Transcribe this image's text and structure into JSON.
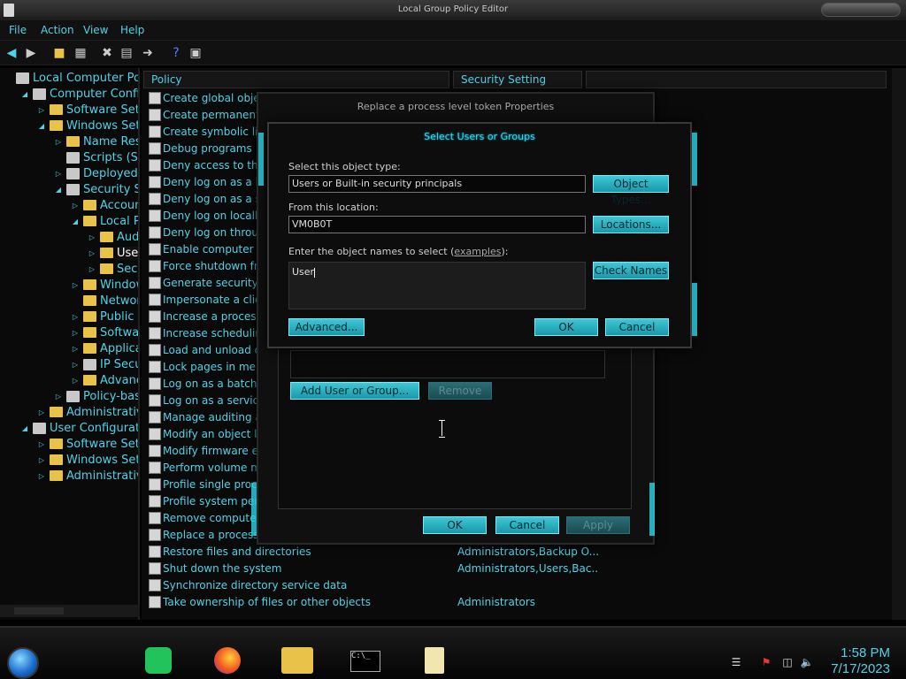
{
  "window": {
    "title": "Local Group Policy Editor"
  },
  "menu": [
    "File",
    "Action",
    "View",
    "Help"
  ],
  "toolbar": {
    "icons": [
      "back-arrow-icon",
      "forward-arrow-icon",
      "up-folder-icon",
      "show-hide-tree-icon",
      "delete-icon",
      "properties-icon",
      "export-list-icon",
      "help-icon",
      "show-action-pane-icon"
    ]
  },
  "tree": [
    {
      "label": "Local Computer Policy",
      "indent": 0,
      "icon": "policy",
      "toggle": ""
    },
    {
      "label": "Computer Configura",
      "indent": 1,
      "icon": "computer",
      "toggle": "down"
    },
    {
      "label": "Software Setting",
      "indent": 2,
      "icon": "folder",
      "toggle": "right"
    },
    {
      "label": "Windows Settin",
      "indent": 2,
      "icon": "folder",
      "toggle": "down"
    },
    {
      "label": "Name Resol",
      "indent": 3,
      "icon": "folder",
      "toggle": "right"
    },
    {
      "label": "Scripts (Star",
      "indent": 3,
      "icon": "page",
      "toggle": ""
    },
    {
      "label": "Deployed Pr",
      "indent": 3,
      "icon": "printer",
      "toggle": "right"
    },
    {
      "label": "Security Set",
      "indent": 3,
      "icon": "security",
      "toggle": "down"
    },
    {
      "label": "Account",
      "indent": 4,
      "icon": "folder",
      "toggle": "right"
    },
    {
      "label": "Local Po",
      "indent": 4,
      "icon": "folder",
      "toggle": "down"
    },
    {
      "label": "Audit",
      "indent": 5,
      "icon": "folder",
      "toggle": "right"
    },
    {
      "label": "User I",
      "indent": 5,
      "icon": "folder",
      "toggle": "right",
      "selected": true
    },
    {
      "label": "Secur",
      "indent": 5,
      "icon": "folder",
      "toggle": "right"
    },
    {
      "label": "Windows",
      "indent": 4,
      "icon": "folder",
      "toggle": "right"
    },
    {
      "label": "Network",
      "indent": 4,
      "icon": "folder",
      "toggle": ""
    },
    {
      "label": "Public Ke",
      "indent": 4,
      "icon": "folder",
      "toggle": "right"
    },
    {
      "label": "Software",
      "indent": 4,
      "icon": "folder",
      "toggle": "right"
    },
    {
      "label": "Applicati",
      "indent": 4,
      "icon": "folder",
      "toggle": "right"
    },
    {
      "label": "IP Securi",
      "indent": 4,
      "icon": "security",
      "toggle": "right"
    },
    {
      "label": "Advance",
      "indent": 4,
      "icon": "folder",
      "toggle": "right"
    },
    {
      "label": "Policy-base",
      "indent": 3,
      "icon": "chart",
      "toggle": "right"
    },
    {
      "label": "Administrative T",
      "indent": 2,
      "icon": "folder",
      "toggle": "right"
    },
    {
      "label": "User Configuration",
      "indent": 1,
      "icon": "computer",
      "toggle": "down"
    },
    {
      "label": "Software Setting",
      "indent": 2,
      "icon": "folder",
      "toggle": "right"
    },
    {
      "label": "Windows Settin",
      "indent": 2,
      "icon": "folder",
      "toggle": "right"
    },
    {
      "label": "Administrative T",
      "indent": 2,
      "icon": "folder",
      "toggle": "right"
    }
  ],
  "columns": {
    "policy": "Policy",
    "setting": "Security Setting"
  },
  "policies": [
    {
      "name": "Create global objects",
      "setting": ""
    },
    {
      "name": "Create permanent s",
      "setting": ""
    },
    {
      "name": "Create symbolic links",
      "setting": ""
    },
    {
      "name": "Debug programs",
      "setting": ""
    },
    {
      "name": "Deny access to this co",
      "setting": ""
    },
    {
      "name": "Deny log on as a batc",
      "setting": ""
    },
    {
      "name": "Deny log on as a serv",
      "setting": ""
    },
    {
      "name": "Deny log on locally",
      "setting": ""
    },
    {
      "name": "Deny log on through",
      "setting": ""
    },
    {
      "name": "Enable computer and",
      "setting": ""
    },
    {
      "name": "Force shutdown from",
      "setting": ""
    },
    {
      "name": "Generate security aud",
      "setting": ""
    },
    {
      "name": "Impersonate a client",
      "setting": ""
    },
    {
      "name": "Increase a process wo",
      "setting": ""
    },
    {
      "name": "Increase scheduling p",
      "setting": ""
    },
    {
      "name": "Load and unload dev",
      "setting": ""
    },
    {
      "name": "Lock pages in memor",
      "setting": ""
    },
    {
      "name": "Log on as a batch job",
      "setting": ""
    },
    {
      "name": "Log on as a service",
      "setting": ""
    },
    {
      "name": "Manage auditing and",
      "setting": ""
    },
    {
      "name": "Modify an object labe",
      "setting": ""
    },
    {
      "name": "Modify firmware envir",
      "setting": ""
    },
    {
      "name": "Perform volume main",
      "setting": ""
    },
    {
      "name": "Profile single proces",
      "setting": ""
    },
    {
      "name": "Profile system perfo",
      "setting": ""
    },
    {
      "name": "Remove computer fr",
      "setting": ""
    },
    {
      "name": "Replace a process le",
      "setting": ""
    },
    {
      "name": "Restore files and directories",
      "setting": "Administrators,Backup O..."
    },
    {
      "name": "Shut down the system",
      "setting": "Administrators,Users,Bac..."
    },
    {
      "name": "Synchronize directory service data",
      "setting": ""
    },
    {
      "name": "Take ownership of files or other objects",
      "setting": "Administrators"
    }
  ],
  "prop_dialog": {
    "title": "Replace a process level token Properties",
    "add_label": "Add User or Group...",
    "remove_label": "Remove",
    "ok_label": "OK",
    "cancel_label": "Cancel",
    "apply_label": "Apply"
  },
  "select_dialog": {
    "title": "Select Users or Groups",
    "type_label": "Select this object type:",
    "type_value": "Users or Built-in security principals",
    "type_button": "Object Types...",
    "loc_label": "From this location:",
    "loc_value": "VM0B0T",
    "loc_button": "Locations...",
    "names_label_pre": "Enter the object names to select (",
    "names_link": "examples",
    "names_label_post": "):",
    "names_value": "User",
    "check_button": "Check Names",
    "advanced_button": "Advanced...",
    "ok_label": "OK",
    "cancel_label": "Cancel"
  },
  "taskbar": {
    "apps": [
      "start-orb-icon",
      "notes-app-icon",
      "firefox-icon",
      "file-explorer-icon",
      "command-prompt-icon",
      "notepad-icon"
    ],
    "time": "1:58 PM",
    "date": "7/17/2023"
  },
  "colors": {
    "accent": "#4fd2e7",
    "button": "#2bb7c7",
    "background": "#0a0a0a"
  }
}
